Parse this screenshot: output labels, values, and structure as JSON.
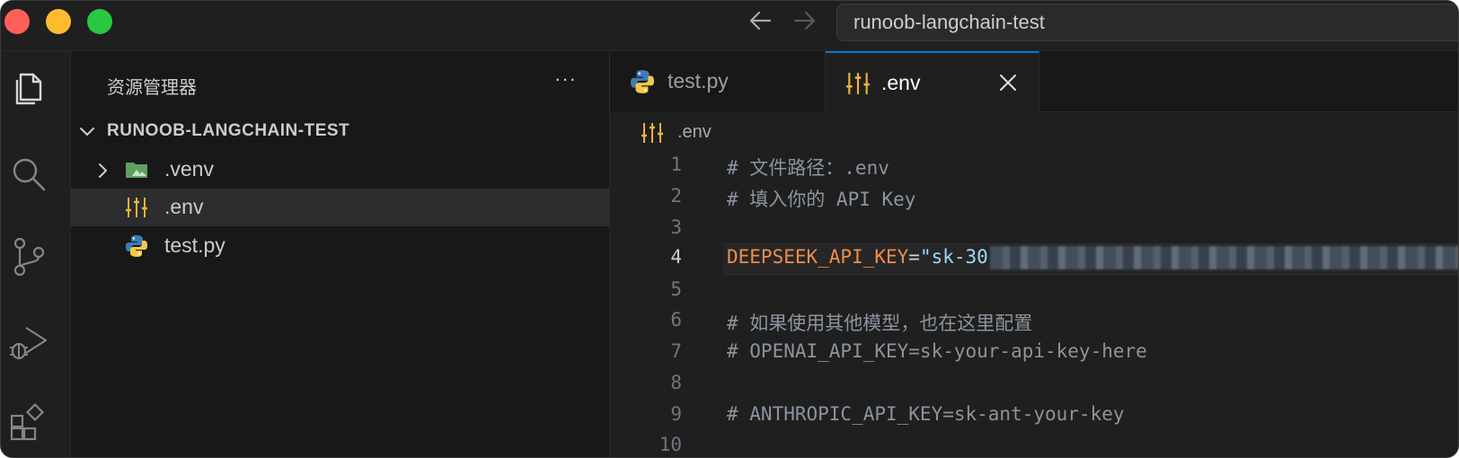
{
  "titlebar": {
    "search_text": "runoob-langchain-test"
  },
  "activity_bar": {
    "icons": [
      "explorer-icon",
      "search-icon",
      "source-control-icon",
      "run-debug-icon",
      "extensions-icon"
    ]
  },
  "sidebar": {
    "title": "资源管理器",
    "more_label": "···",
    "root_folder": "RUNOOB-LANGCHAIN-TEST",
    "items": [
      {
        "label": ".venv",
        "icon": "folder-icon",
        "expandable": true
      },
      {
        "label": ".env",
        "icon": "env-settings-icon",
        "selected": true
      },
      {
        "label": "test.py",
        "icon": "python-icon"
      }
    ]
  },
  "tabs": [
    {
      "label": "test.py",
      "icon": "python-icon",
      "active": false
    },
    {
      "label": ".env",
      "icon": "env-settings-icon",
      "active": true
    }
  ],
  "breadcrumb": {
    "label": ".env"
  },
  "editor": {
    "current_line": 4,
    "lines": [
      {
        "no": "1",
        "text": "# 文件路径：.env"
      },
      {
        "no": "2",
        "text": "# 填入你的 API Key"
      },
      {
        "no": "3",
        "text": ""
      },
      {
        "no": "4",
        "key": "DEEPSEEK_API_KEY",
        "eq": "=",
        "value_prefix": "\"sk-30"
      },
      {
        "no": "5",
        "text": ""
      },
      {
        "no": "6",
        "text": "# 如果使用其他模型，也在这里配置"
      },
      {
        "no": "7",
        "text": "# OPENAI_API_KEY=sk-your-api-key-here"
      },
      {
        "no": "8",
        "text": ""
      },
      {
        "no": "9",
        "text": "# ANTHROPIC_API_KEY=sk-ant-your-key"
      },
      {
        "no": "10",
        "text": ""
      }
    ]
  },
  "colors": {
    "accent": "#0078d4",
    "key": "#f08d49",
    "string": "#9cdcfe",
    "comment": "#8b949e",
    "env_icon": "#e8b43a",
    "folder": "#5fa060"
  }
}
